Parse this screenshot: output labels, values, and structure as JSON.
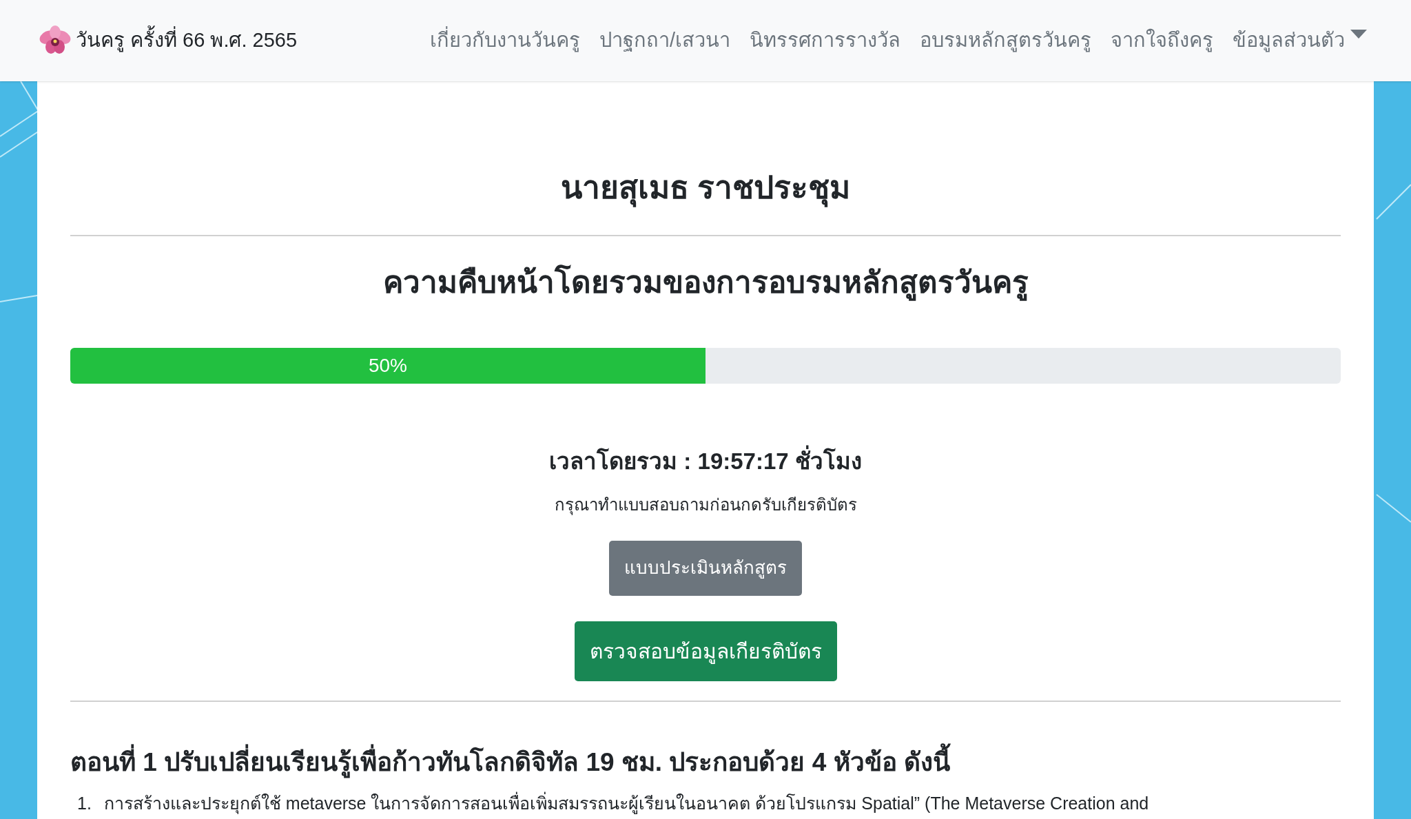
{
  "navbar": {
    "brand": "วันครู ครั้งที่ 66 พ.ศ. 2565",
    "items": [
      {
        "label": "เกี่ยวกับงานวันครู",
        "kind": "link"
      },
      {
        "label": "ปาฐกถา/เสวนา",
        "kind": "link"
      },
      {
        "label": "นิทรรศการรางวัล",
        "kind": "link"
      },
      {
        "label": "อบรมหลักสูตรวันครู",
        "kind": "link"
      },
      {
        "label": "จากใจถึงครู",
        "kind": "link"
      },
      {
        "label": "ข้อมูลส่วนตัว",
        "kind": "dropdown"
      }
    ]
  },
  "name": "นายสุเมธ ราชประชุม",
  "progress": {
    "title": "ความคืบหน้าโดยรวมของการอบรมหลักสูตรวันครู",
    "level": 0.5,
    "label": "50%"
  },
  "total_time": "เวลาโดยรวม : 19:57:17 ชั่วโมง",
  "note": "กรุณาทำแบบสอบถามก่อนกดรับเกียรติบัตร",
  "buttons": [
    {
      "label": "แบบประเมินหลักสูตร",
      "kind": "secondary"
    },
    {
      "label": "ตรวจสอบข้อมูลเกียรติบัตร",
      "kind": "success"
    }
  ],
  "section": {
    "heading": "ตอนที่ 1 ปรับเปลี่ยนเรียนรู้เพื่อก้าวทันโลกดิจิทัล 19 ชม. ประกอบด้วย 4 หัวข้อ ดังนี้",
    "items": [
      {
        "number": "1.",
        "text": "การสร้างและประยุกต์ใช้ metaverse ในการจัดการสอนเพื่อเพิ่มสมรรถนะผู้เรียนในอนาคต ด้วยโปรแกรม Spatial” (The Metaverse Creation and"
      }
    ]
  }
}
